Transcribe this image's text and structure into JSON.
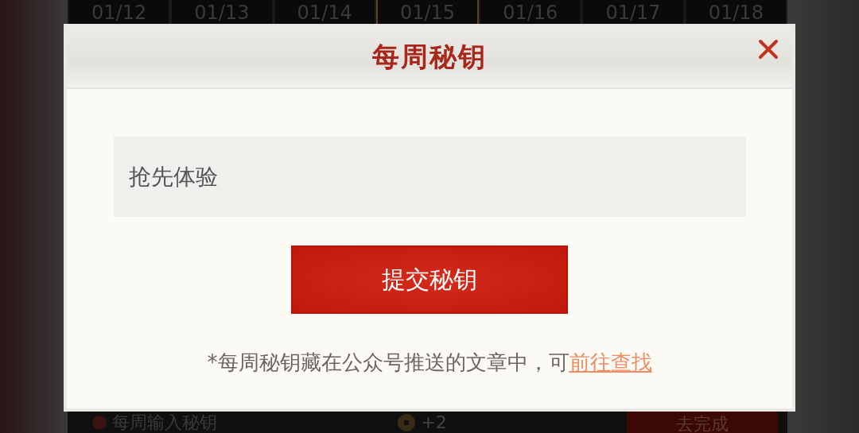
{
  "dates": [
    {
      "label": "01/12",
      "selected": false
    },
    {
      "label": "01/13",
      "selected": false
    },
    {
      "label": "01/14",
      "selected": false
    },
    {
      "label": "01/15",
      "selected": true
    },
    {
      "label": "01/16",
      "selected": false
    },
    {
      "label": "01/17",
      "selected": false
    },
    {
      "label": "01/18",
      "selected": false
    }
  ],
  "dialog": {
    "title": "每周秘钥",
    "input": {
      "value": "抢先体验"
    },
    "submit": "提交秘钥",
    "hint": "*每周秘钥藏在公众号推送的文章中，可",
    "hint_link": "前往查找"
  },
  "task": {
    "label": "每周输入秘钥",
    "reward": "+2",
    "action": "去完成"
  }
}
